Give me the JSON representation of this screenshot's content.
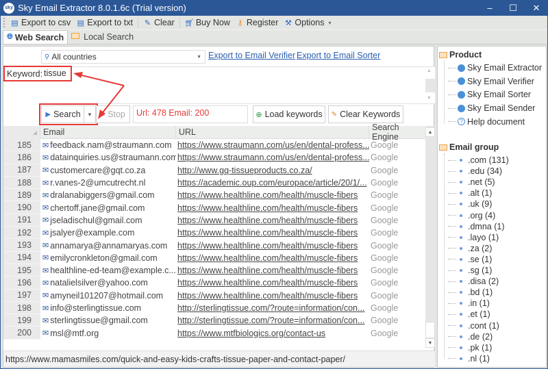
{
  "window": {
    "title": "Sky Email Extractor 8.0.1.6c (Trial version)",
    "logo_text": "sky",
    "minimize": "–",
    "maximize": "☐",
    "close": "✕"
  },
  "toolbar": {
    "items": [
      {
        "label": "Export to csv",
        "icon": "export-csv-icon"
      },
      {
        "label": "Export to txt",
        "icon": "export-txt-icon"
      },
      {
        "label": "Clear",
        "icon": "broom-icon"
      },
      {
        "label": "Buy Now",
        "icon": "cart-icon"
      },
      {
        "label": "Register",
        "icon": "key-icon"
      },
      {
        "label": "Options",
        "icon": "wrench-icon"
      }
    ],
    "options_caret": "▾"
  },
  "tabs": [
    {
      "label": "Web Search",
      "icon": "globe-icon",
      "active": true
    },
    {
      "label": "Local Search",
      "icon": "folder-icon",
      "active": false
    }
  ],
  "search": {
    "country": "All countries",
    "export_verifier": "Export to Email Verifier",
    "export_sorter": "Export to Email Sorter",
    "keyword_label": "Keyword:",
    "keyword_value": "tissue",
    "search_button": "Search",
    "stop_button": "Stop",
    "status": "Url: 478 Email: 200",
    "load_keywords": "Load keywords",
    "clear_keywords": "Clear Keywords"
  },
  "table": {
    "columns": [
      "Email",
      "URL",
      "Search Engine"
    ],
    "rows": [
      {
        "num": "185",
        "email": "feedback.nam@straumann.com",
        "url": "https://www.straumann.com/us/en/dental-profess...",
        "engine": "Google"
      },
      {
        "num": "186",
        "email": "datainquiries.us@straumann.com",
        "url": "https://www.straumann.com/us/en/dental-profess...",
        "engine": "Google"
      },
      {
        "num": "187",
        "email": "customercare@gqt.co.za",
        "url": "http://www.gq-tissueproducts.co.za/",
        "engine": "Google"
      },
      {
        "num": "188",
        "email": "r.vanes-2@umcutrecht.nl",
        "url": "https://academic.oup.com/europace/article/20/1/...",
        "engine": "Google"
      },
      {
        "num": "189",
        "email": "dralanabiggers@gmail.com",
        "url": "https://www.healthline.com/health/muscle-fibers",
        "engine": "Google"
      },
      {
        "num": "190",
        "email": "chertoff.jane@gmail.com",
        "url": "https://www.healthline.com/health/muscle-fibers",
        "engine": "Google"
      },
      {
        "num": "191",
        "email": "jseladischul@gmail.com",
        "url": "https://www.healthline.com/health/muscle-fibers",
        "engine": "Google"
      },
      {
        "num": "192",
        "email": "jsalyer@example.com",
        "url": "https://www.healthline.com/health/muscle-fibers",
        "engine": "Google"
      },
      {
        "num": "193",
        "email": "annamarya@annamaryas.com",
        "url": "https://www.healthline.com/health/muscle-fibers",
        "engine": "Google"
      },
      {
        "num": "194",
        "email": "emilycronkleton@gmail.com",
        "url": "https://www.healthline.com/health/muscle-fibers",
        "engine": "Google"
      },
      {
        "num": "195",
        "email": "healthline-ed-team@example.c...",
        "url": "https://www.healthline.com/health/muscle-fibers",
        "engine": "Google"
      },
      {
        "num": "196",
        "email": "natalielsilver@yahoo.com",
        "url": "https://www.healthline.com/health/muscle-fibers",
        "engine": "Google"
      },
      {
        "num": "197",
        "email": "amyneil101207@hotmail.com",
        "url": "https://www.healthline.com/health/muscle-fibers",
        "engine": "Google"
      },
      {
        "num": "198",
        "email": "info@sterlingtissue.com",
        "url": "http://sterlingtissue.com/?route=information/con...",
        "engine": "Google"
      },
      {
        "num": "199",
        "email": "sterlingtissue@gmail.com",
        "url": "http://sterlingtissue.com/?route=information/con...",
        "engine": "Google"
      },
      {
        "num": "200",
        "email": "msl@mtf.org",
        "url": "https://www.mtfbiologics.org/contact-us",
        "engine": "Google"
      }
    ]
  },
  "statusbar": {
    "text": "https://www.mamasmiles.com/quick-and-easy-kids-crafts-tissue-paper-and-contact-paper/"
  },
  "sidebar": {
    "product_title": "Product",
    "products": [
      {
        "label": "Sky Email Extractor",
        "icon": "globe-icon"
      },
      {
        "label": "Sky Email Verifier",
        "icon": "globe-icon"
      },
      {
        "label": "Sky Email Sorter",
        "icon": "globe-icon"
      },
      {
        "label": "Sky Email Sender",
        "icon": "globe-icon"
      },
      {
        "label": "Help document",
        "icon": "help-icon"
      }
    ],
    "group_title": "Email group",
    "groups": [
      ".com (131)",
      ".edu (34)",
      ".net (5)",
      ".alt (1)",
      ".uk (9)",
      ".org (4)",
      ".dmna (1)",
      ".layo (1)",
      ".za (2)",
      ".se (1)",
      ".sg (1)",
      ".disa (2)",
      ".bd (1)",
      ".in (1)",
      ".et (1)",
      ".cont (1)",
      ".de (2)",
      ".pk (1)",
      ".nl (1)"
    ]
  },
  "colors": {
    "titlebar": "#2b5797",
    "annotation_red": "#e53935",
    "status_red": "#e53935",
    "link_blue": "#2a5db0"
  }
}
